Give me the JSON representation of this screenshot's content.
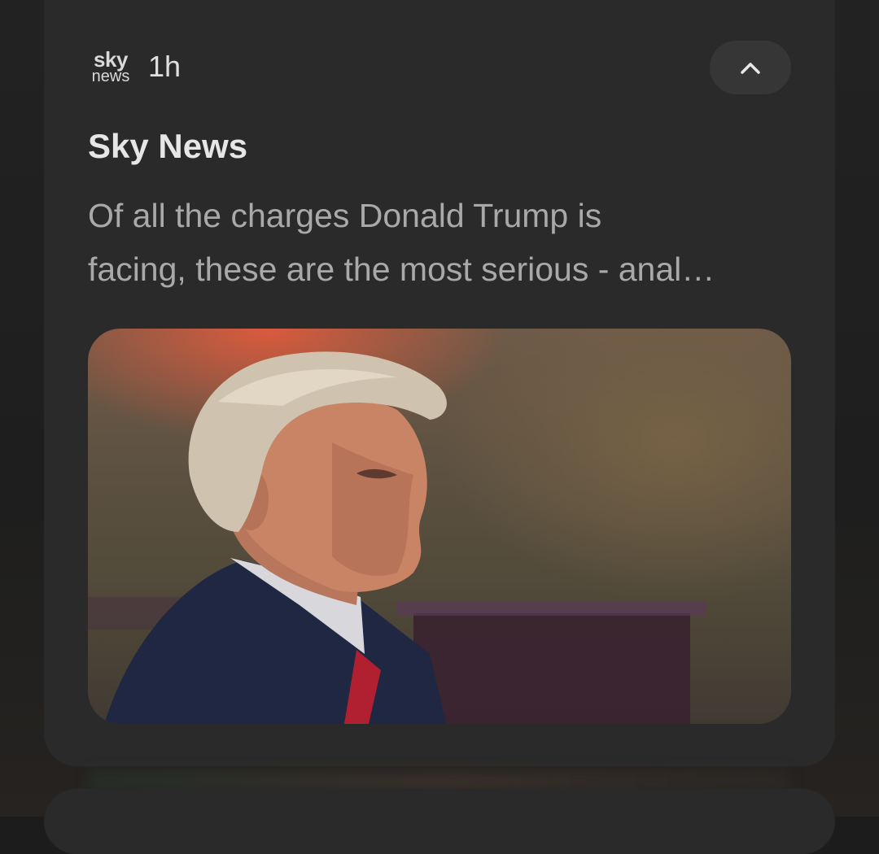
{
  "notification": {
    "source_logo": {
      "line1": "sky",
      "line2": "news"
    },
    "time_ago": "1h",
    "title": "Sky News",
    "body_lines": [
      "Of all the charges Donald Trump is",
      "facing, these are the most serious - anal…"
    ],
    "collapse_icon": "chevron-up-icon"
  },
  "colors": {
    "card_bg": "#2a2a2a",
    "button_bg": "#363636",
    "title_color": "#e6e6e6",
    "body_color": "#a9a9a9"
  }
}
